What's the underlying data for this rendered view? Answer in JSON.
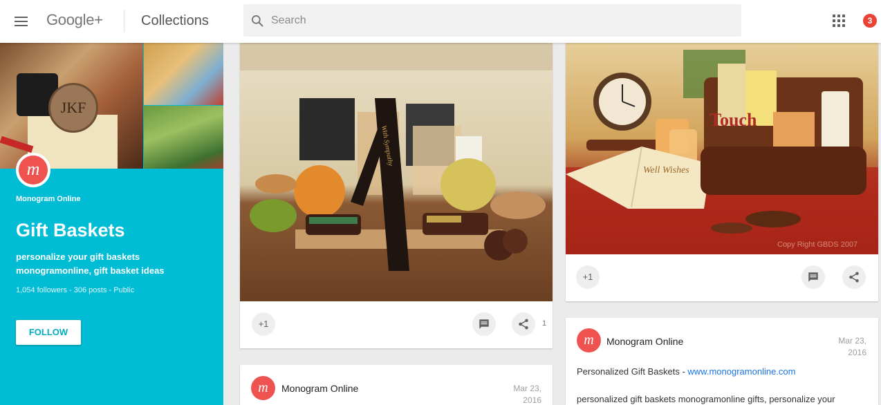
{
  "header": {
    "logo": "Google+",
    "section": "Collections",
    "search_placeholder": "Search",
    "notifications_count": "3"
  },
  "collection": {
    "owner": "Monogram Online",
    "avatar_letter": "m",
    "cover_monogram": "JKF",
    "title": "Gift Baskets",
    "description": "personalize your gift baskets monogramonline, gift basket ideas",
    "stats": "1,054 followers - 306 posts - Public",
    "follow_label": "FOLLOW"
  },
  "cards": {
    "card1": {
      "plus_one": "+1",
      "share_count": "1",
      "ribbon_text": "With Sympathy"
    },
    "card2": {
      "plus_one": "+1",
      "book_text": "Well Wishes",
      "tin_text": "Touch",
      "copyright": "Copy Right GBDS 2007"
    },
    "post1": {
      "author": "Monogram Online",
      "date_line1": "Mar 23,",
      "date_line2": "2016",
      "text_prefix": "Personalized Gift Baskets - ",
      "link": "www.monogramonline.com",
      "text2": "personalized gift baskets monogramonline gifts, personalize your"
    },
    "post2": {
      "author": "Monogram Online",
      "date_line1": "Mar 23,",
      "date_line2": "2016"
    }
  },
  "colors": {
    "collection_bg": "#00bcd4",
    "avatar": "#ef5350",
    "notification_badge": "#ea4335",
    "link": "#1a73e8"
  },
  "icons": [
    "menu-icon",
    "search-icon",
    "apps-icon",
    "comment-icon",
    "share-icon"
  ]
}
